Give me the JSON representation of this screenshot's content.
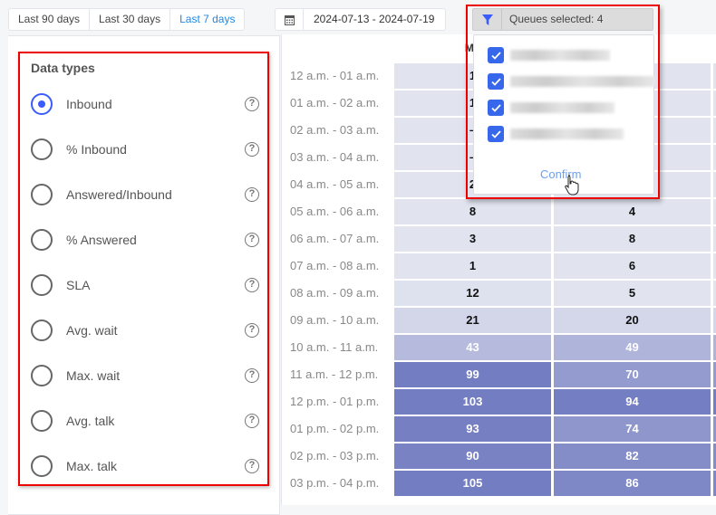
{
  "range_buttons": [
    {
      "label": "Last 90 days",
      "active": false
    },
    {
      "label": "Last 30 days",
      "active": false
    },
    {
      "label": "Last 7 days",
      "active": true
    }
  ],
  "date_range": {
    "icon": "calendar-icon",
    "value": "2024-07-13 - 2024-07-19"
  },
  "data_types": {
    "title": "Data types",
    "selected": "Inbound",
    "items": [
      "Inbound",
      "% Inbound",
      "Answered/Inbound",
      "% Answered",
      "SLA",
      "Avg. wait",
      "Max. wait",
      "Avg. talk",
      "Max. talk"
    ],
    "help_icon": "help-circle-icon"
  },
  "queue_filter": {
    "icon": "filter-icon",
    "label": "Queues selected: 4",
    "queues_checked": [
      true,
      true,
      true,
      true
    ],
    "confirm_label": "Confirm"
  },
  "grid": {
    "column_headers": [
      "Mo",
      ""
    ],
    "rows": [
      {
        "time": "12 a.m. - 01 a.m.",
        "values": [
          "1",
          ""
        ]
      },
      {
        "time": "01 a.m. - 02 a.m.",
        "values": [
          "1",
          ""
        ]
      },
      {
        "time": "02 a.m. - 03 a.m.",
        "values": [
          "–",
          ""
        ]
      },
      {
        "time": "03 a.m. - 04 a.m.",
        "values": [
          "–",
          ""
        ]
      },
      {
        "time": "04 a.m. - 05 a.m.",
        "values": [
          "2",
          ""
        ]
      },
      {
        "time": "05 a.m. - 06 a.m.",
        "values": [
          "8",
          "4"
        ]
      },
      {
        "time": "06 a.m. - 07 a.m.",
        "values": [
          "3",
          "8"
        ]
      },
      {
        "time": "07 a.m. - 08 a.m.",
        "values": [
          "1",
          "6"
        ]
      },
      {
        "time": "08 a.m. - 09 a.m.",
        "values": [
          "12",
          "5"
        ]
      },
      {
        "time": "09 a.m. - 10 a.m.",
        "values": [
          "21",
          "20"
        ]
      },
      {
        "time": "10 a.m. - 11 a.m.",
        "values": [
          "43",
          "49"
        ]
      },
      {
        "time": "11 a.m. - 12 p.m.",
        "values": [
          "99",
          "70"
        ]
      },
      {
        "time": "12 p.m. - 01 p.m.",
        "values": [
          "103",
          "94"
        ]
      },
      {
        "time": "01 p.m. - 02 p.m.",
        "values": [
          "93",
          "74"
        ]
      },
      {
        "time": "02 p.m. - 03 p.m.",
        "values": [
          "90",
          "82"
        ]
      },
      {
        "time": "03 p.m. - 04 p.m.",
        "values": [
          "105",
          "86"
        ]
      }
    ],
    "colors": {
      "low": "#e1e3ef",
      "high": "#737dc1"
    }
  }
}
